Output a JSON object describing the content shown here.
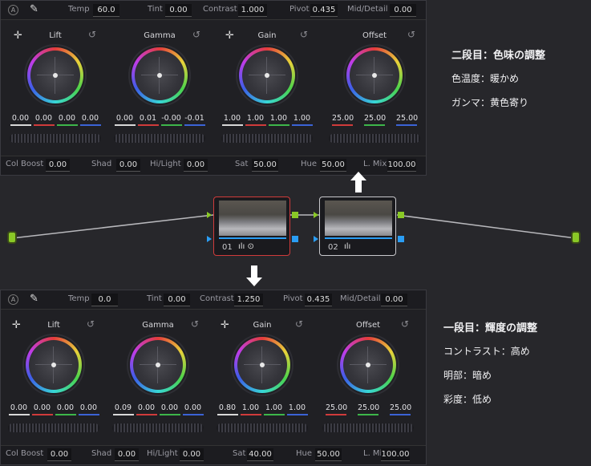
{
  "top_panel": {
    "bar": {
      "temp_label": "Temp",
      "temp_value": "60.0",
      "tint_label": "Tint",
      "tint_value": "0.00",
      "contrast_label": "Contrast",
      "contrast_value": "1.000",
      "pivot_label": "Pivot",
      "pivot_value": "0.435",
      "middetail_label": "Mid/Detail",
      "middetail_value": "0.00"
    },
    "wheels": [
      {
        "name": "Lift",
        "values": [
          "0.00",
          "0.00",
          "0.00",
          "0.00"
        ]
      },
      {
        "name": "Gamma",
        "values": [
          "0.00",
          "0.01",
          "-0.00",
          "-0.01"
        ]
      },
      {
        "name": "Gain",
        "values": [
          "1.00",
          "1.00",
          "1.00",
          "1.00"
        ]
      },
      {
        "name": "Offset",
        "values": [
          "25.00",
          "25.00",
          "25.00"
        ]
      }
    ],
    "bottom": {
      "colboost_label": "Col Boost",
      "colboost_value": "0.00",
      "shad_label": "Shad",
      "shad_value": "0.00",
      "hilight_label": "Hi/Light",
      "hilight_value": "0.00",
      "sat_label": "Sat",
      "sat_value": "50.00",
      "hue_label": "Hue",
      "hue_value": "50.00",
      "lmix_label": "L. Mix",
      "lmix_value": "100.00"
    }
  },
  "bottom_panel": {
    "bar": {
      "temp_label": "Temp",
      "temp_value": "0.0",
      "tint_label": "Tint",
      "tint_value": "0.00",
      "contrast_label": "Contrast",
      "contrast_value": "1.250",
      "pivot_label": "Pivot",
      "pivot_value": "0.435",
      "middetail_label": "Mid/Detail",
      "middetail_value": "0.00"
    },
    "wheels": [
      {
        "name": "Lift",
        "values": [
          "0.00",
          "0.00",
          "0.00",
          "0.00"
        ]
      },
      {
        "name": "Gamma",
        "values": [
          "0.09",
          "0.00",
          "0.00",
          "0.00"
        ]
      },
      {
        "name": "Gain",
        "values": [
          "0.80",
          "1.00",
          "1.00",
          "1.00"
        ]
      },
      {
        "name": "Offset",
        "values": [
          "25.00",
          "25.00",
          "25.00"
        ]
      }
    ],
    "bottom": {
      "colboost_label": "Col Boost",
      "colboost_value": "0.00",
      "shad_label": "Shad",
      "shad_value": "0.00",
      "hilight_label": "Hi/Light",
      "hilight_value": "0.00",
      "sat_label": "Sat",
      "sat_value": "40.00",
      "hue_label": "Hue",
      "hue_value": "50.00",
      "lmix_label": "L. Mix",
      "lmix_value": "100.00"
    }
  },
  "nodes": [
    {
      "label": "01",
      "selected": true
    },
    {
      "label": "02",
      "selected": false
    }
  ],
  "icons": {
    "a_circle": "A",
    "reset": "↺",
    "cross": "✛",
    "picker": "⁄"
  },
  "notes_top": {
    "heading": "二段目：色味の調整",
    "line1": "色温度：暖かめ",
    "line2": "ガンマ：黄色寄り"
  },
  "notes_bottom": {
    "heading": "一段目：輝度の調整",
    "line1": "コントラスト：高め",
    "line2": "明部：暗め",
    "line3": "彩度：低め"
  },
  "colors": {
    "accent_red": "#d03b3b",
    "node_ports_green": "#8ac926",
    "node_ports_blue": "#2a9df4"
  }
}
